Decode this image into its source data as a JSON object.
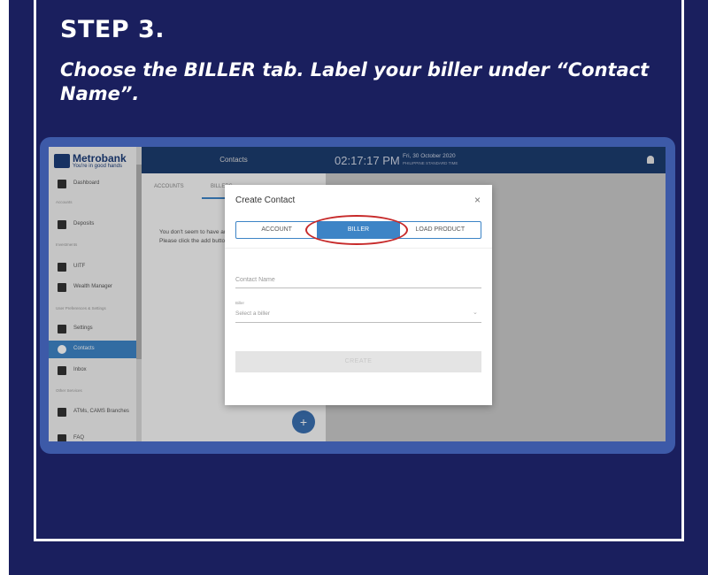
{
  "slide": {
    "step_title": "STEP 3.",
    "instruction": "Choose the BILLER tab. Label your biller under “Contact Name”."
  },
  "app": {
    "logo_name": "Metrobank",
    "logo_tagline": "You're in good hands",
    "sidebar": {
      "items": [
        {
          "label": "Dashboard",
          "icon": "dashboard-icon"
        },
        {
          "label": "Deposits",
          "icon": "bank-icon"
        },
        {
          "label": "UITF",
          "icon": "chart-icon"
        },
        {
          "label": "Wealth Manager",
          "icon": "briefcase-icon"
        },
        {
          "label": "Settings",
          "icon": "gear-icon"
        },
        {
          "label": "Contacts",
          "icon": "contact-icon",
          "active": true
        },
        {
          "label": "Inbox",
          "icon": "inbox-icon"
        },
        {
          "label": "ATMs, CAMS Branches",
          "icon": "location-icon"
        },
        {
          "label": "FAQ",
          "icon": "faq-icon"
        }
      ],
      "sections": [
        "Accounts",
        "Investments",
        "User Preferences & Settings",
        "Other Services"
      ]
    },
    "contacts_panel": {
      "header": "Contacts",
      "tabs": [
        "ACCOUNTS",
        "BILLERS"
      ],
      "empty_line1": "You don't seem to have any contacts",
      "empty_line2": "Please click the add button to add"
    },
    "top_bar": {
      "time": "02:17:17 PM",
      "date": "Fri, 30 October 2020",
      "timezone": "PHILIPPINE STANDARD TIME"
    },
    "modal": {
      "title": "Create Contact",
      "close": "×",
      "tabs": [
        "ACCOUNT",
        "BILLER",
        "LOAD PRODUCT"
      ],
      "selected_tab": "BILLER",
      "contact_name_placeholder": "Contact Name",
      "biller_label": "Biller",
      "biller_placeholder": "Select a biller",
      "create_label": "CREATE"
    }
  },
  "colors": {
    "slide_bg": "#1a1f5e",
    "frame_blue": "#3d5aa8",
    "accent": "#3d84c6",
    "highlight_red": "#c72a2a"
  }
}
